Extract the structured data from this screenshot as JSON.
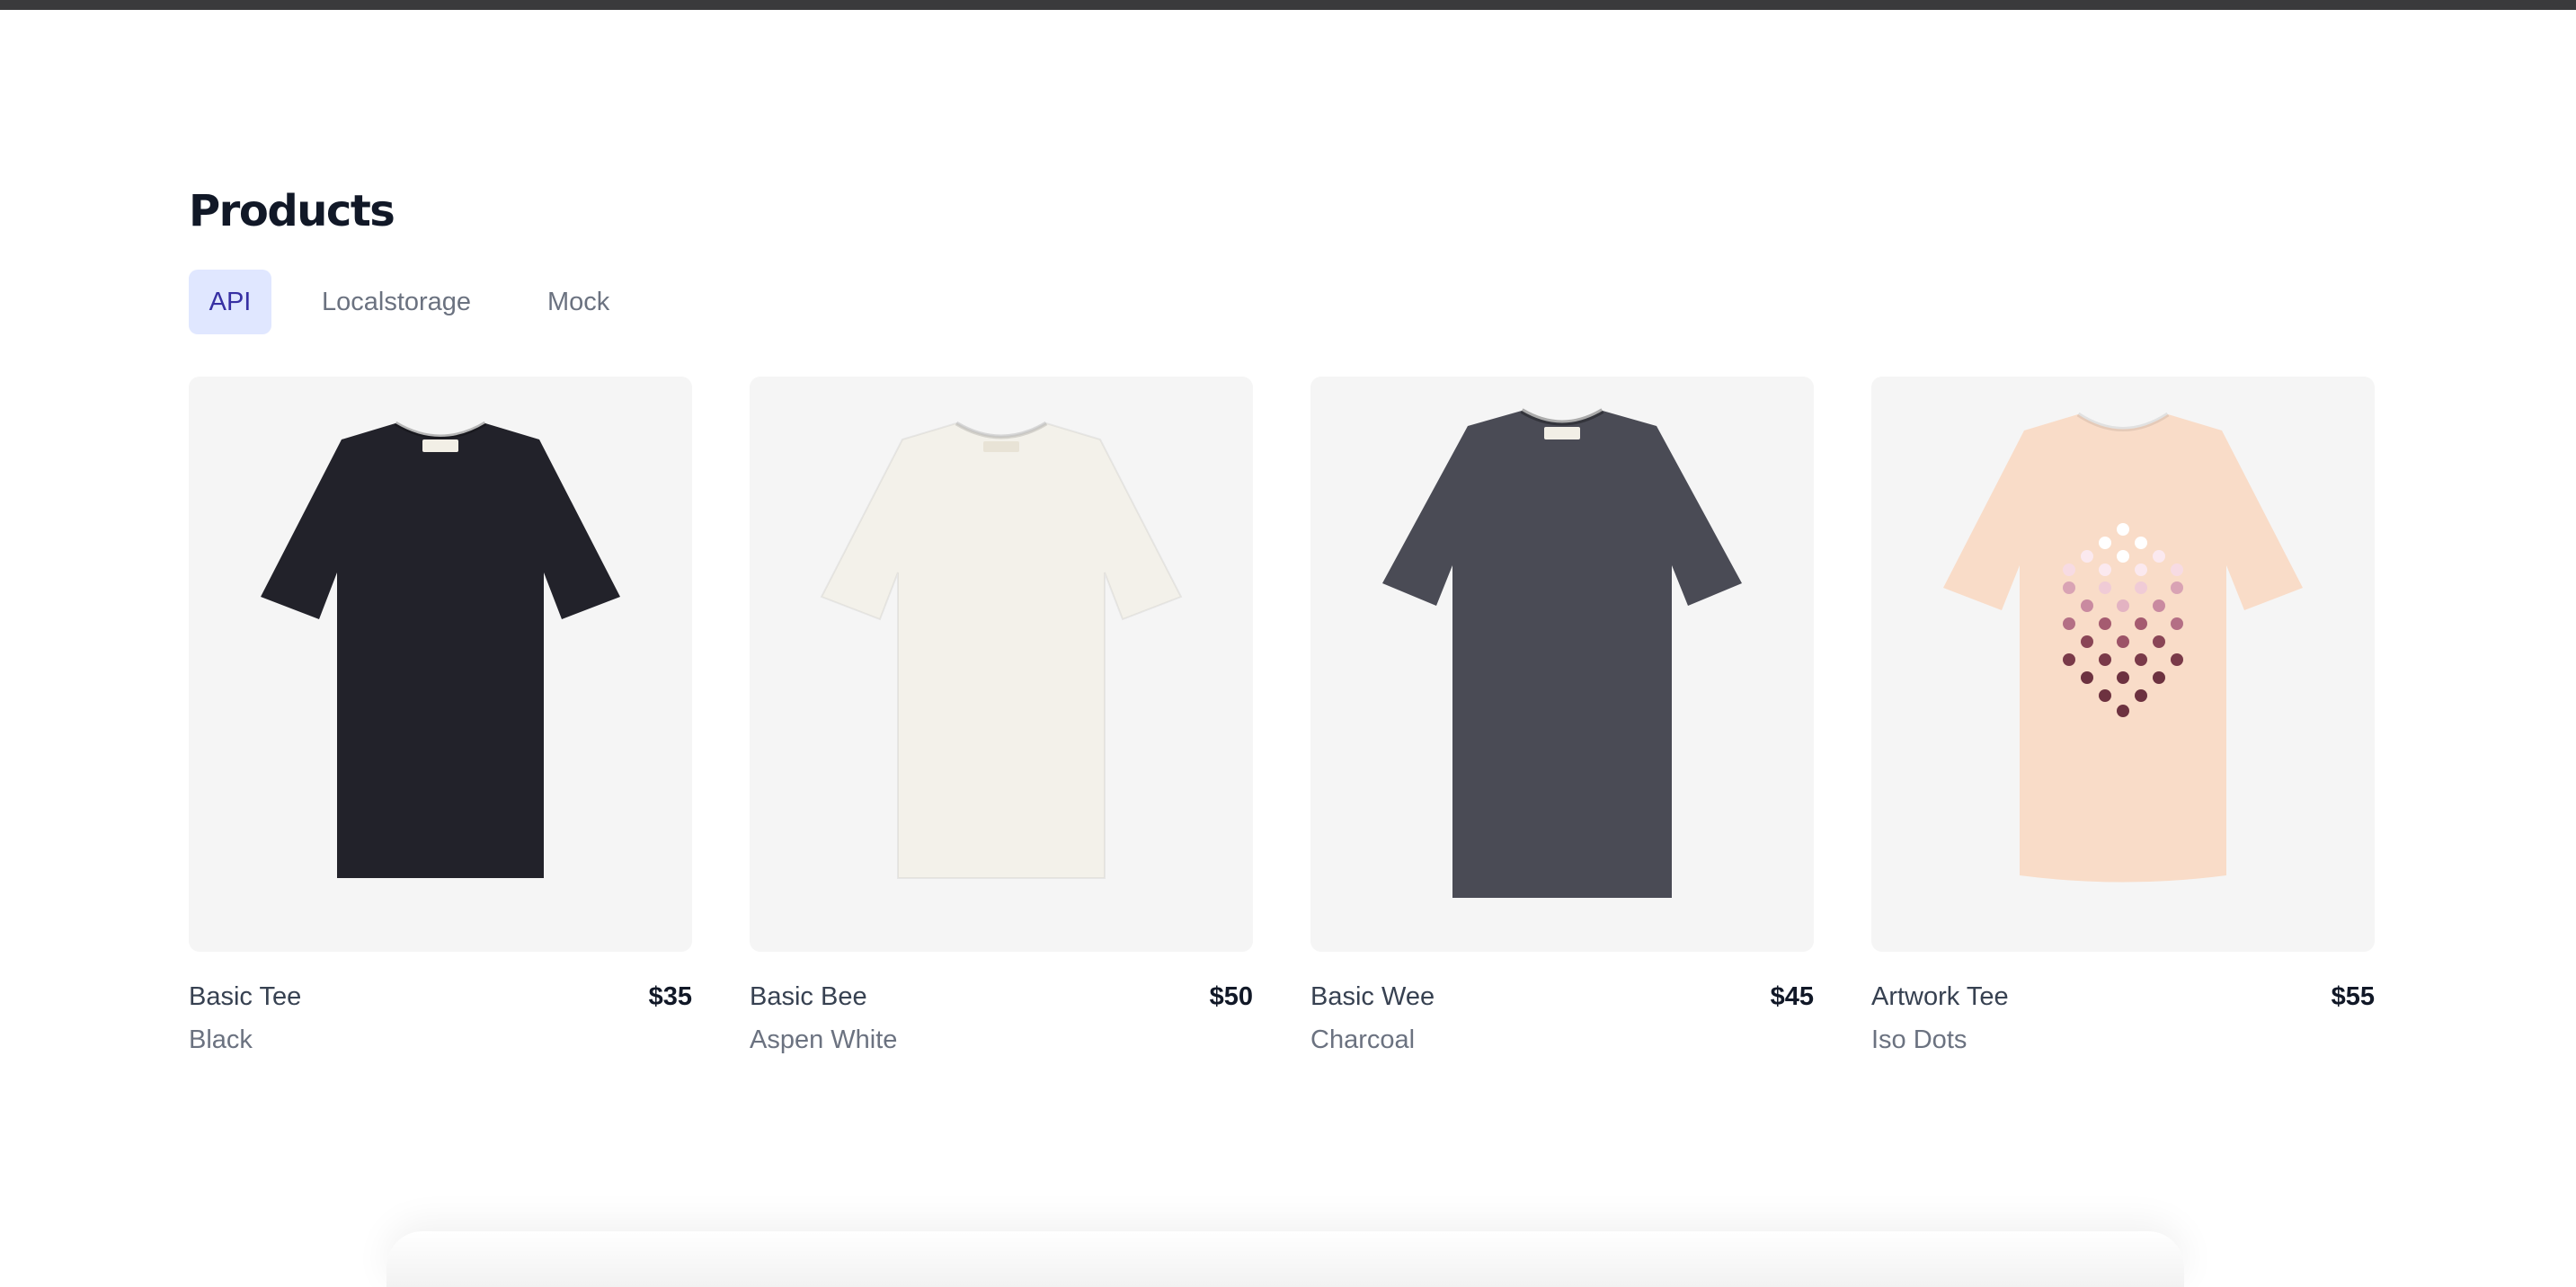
{
  "page_title": "Products",
  "tabs": [
    {
      "label": "API",
      "active": true
    },
    {
      "label": "Localstorage",
      "active": false
    },
    {
      "label": "Mock",
      "active": false
    }
  ],
  "products": [
    {
      "name": "Basic Tee",
      "price": "$35",
      "color": "Black",
      "shirt_color": "#22222a",
      "icon": "black-tshirt-image"
    },
    {
      "name": "Basic Bee",
      "price": "$50",
      "color": "Aspen White",
      "shirt_color": "#f3f1ea",
      "icon": "white-tshirt-image"
    },
    {
      "name": "Basic Wee",
      "price": "$45",
      "color": "Charcoal",
      "shirt_color": "#4a4b55",
      "icon": "charcoal-tshirt-image"
    },
    {
      "name": "Artwork Tee",
      "price": "$55",
      "color": "Iso Dots",
      "shirt_color": "#f9dcc8",
      "icon": "peach-artwork-tshirt-image"
    }
  ],
  "colors": {
    "accent_bg": "#e0e7ff",
    "accent_text": "#3730a3",
    "topbar": "#3a3a3c"
  }
}
